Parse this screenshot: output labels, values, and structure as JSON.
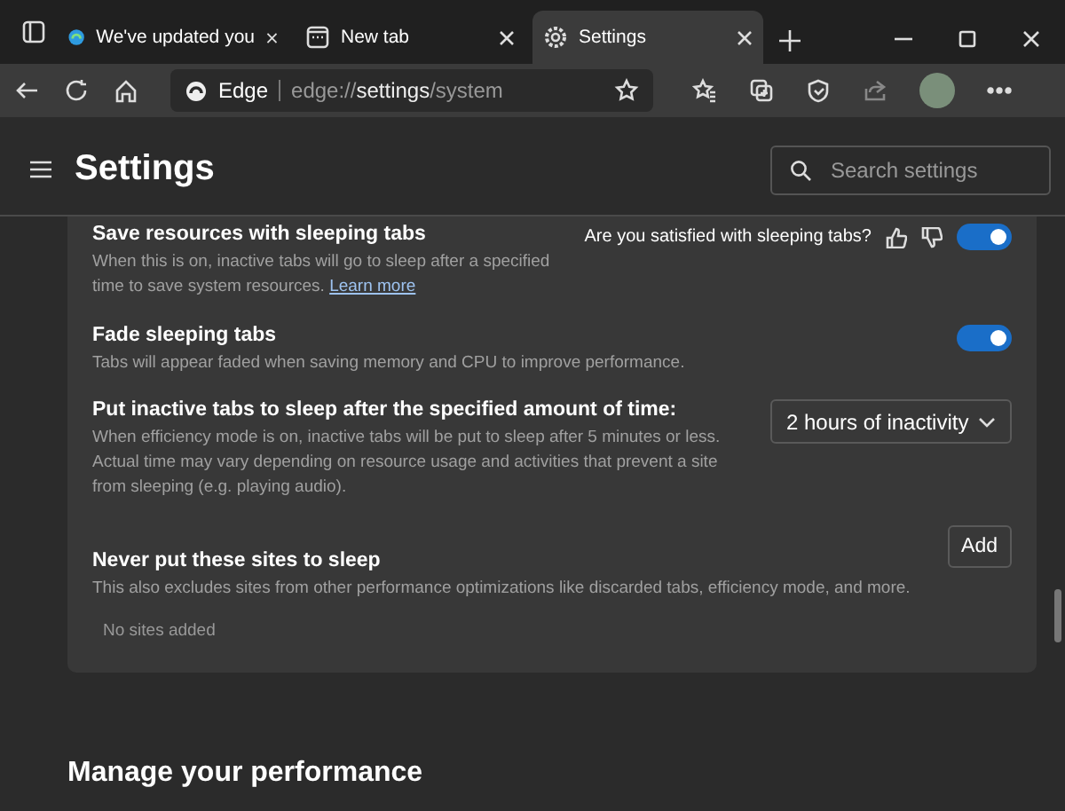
{
  "tabs": [
    {
      "title": "We've updated you",
      "selected": false,
      "kind": "edge"
    },
    {
      "title": "New tab",
      "selected": false,
      "kind": "newtab"
    },
    {
      "title": "Settings",
      "selected": true,
      "kind": "settings"
    }
  ],
  "address_bar": {
    "site_label": "Edge",
    "url_prefix": "edge://",
    "url_main": "settings",
    "url_suffix": "/system"
  },
  "page": {
    "title": "Settings",
    "search": {
      "placeholder": "Search settings"
    }
  },
  "settings": [
    {
      "kind": "toggle",
      "title": "Save resources with sleeping tabs",
      "description": "When this is on, inactive tabs will go to sleep after a specified time to save system resources.",
      "link": "Learn more",
      "feedback": "Are you satisfied with sleeping tabs?",
      "on": true
    },
    {
      "kind": "toggle",
      "title": "Fade sleeping tabs",
      "description": "Tabs will appear faded when saving memory and CPU to improve performance.",
      "on": true
    },
    {
      "kind": "dropdown",
      "title": "Put inactive tabs to sleep after the specified amount of time:",
      "description": "When efficiency mode is on, inactive tabs will be put to sleep after 5 minutes or less. Actual time may vary depending on resource usage and activities that prevent a site from sleeping (e.g. playing audio).",
      "value": "2 hours of inactivity"
    },
    {
      "kind": "sites",
      "title": "Never put these sites to sleep",
      "description": "This also excludes sites from other performance optimizations like discarded tabs, efficiency mode, and more.",
      "button": "Add",
      "empty": "No sites added"
    }
  ],
  "next_section": {
    "title": "Manage your performance"
  }
}
